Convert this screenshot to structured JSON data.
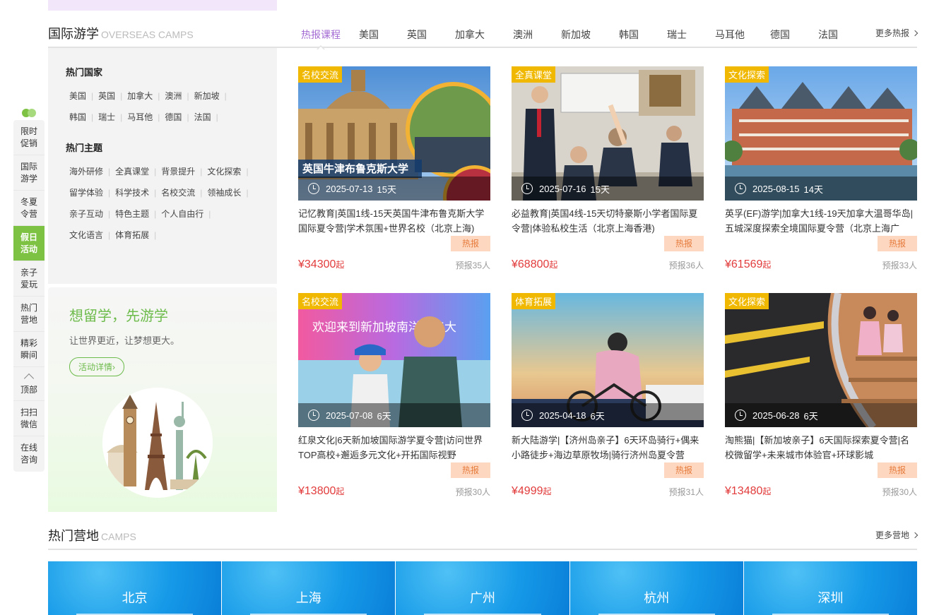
{
  "sidenav": {
    "items": [
      {
        "label": "限时促销",
        "active": false
      },
      {
        "label": "国际游学",
        "active": false
      },
      {
        "label": "冬夏令营",
        "active": false
      },
      {
        "label": "假日活动",
        "active": true
      },
      {
        "label": "亲子爱玩",
        "active": false
      },
      {
        "label": "热门营地",
        "active": false
      },
      {
        "label": "精彩瞬间",
        "active": false
      }
    ],
    "top_label": "顶部",
    "extra": [
      "扫扫微信",
      "在线咨询"
    ]
  },
  "overseas": {
    "title": "国际游学",
    "title_en": "OVERSEAS CAMPS",
    "tabs": [
      "热报课程",
      "美国",
      "英国",
      "加拿大",
      "澳洲",
      "新加坡",
      "韩国",
      "瑞士",
      "马耳他",
      "德国",
      "法国"
    ],
    "more": "更多热报"
  },
  "left_panel": {
    "countries_title": "热门国家",
    "countries": [
      "美国",
      "英国",
      "加拿大",
      "澳洲",
      "新加坡",
      "韩国",
      "瑞士",
      "马耳他",
      "德国",
      "法国"
    ],
    "themes_title": "热门主题",
    "themes": [
      "海外研修",
      "全真课堂",
      "背景提升",
      "文化探索",
      "留学体验",
      "科学技术",
      "名校交流",
      "领袖成长",
      "亲子互动",
      "特色主题",
      "个人自由行",
      "文化语言",
      "体育拓展"
    ]
  },
  "promo": {
    "title": "想留学，先游学",
    "subtitle": "让世界更近，让梦想更大。",
    "button": "活动详情›"
  },
  "cards": [
    {
      "tag": "名校交流",
      "date": "2025-07-13",
      "duration": "15天",
      "title": "记忆教育|英国1线-15天英国牛津布鲁克斯大学国际夏令营|学术氛围+世界名校（北京上海)",
      "hot": "热报",
      "price": "¥34300",
      "price_suffix": "起",
      "joined": "预报35人",
      "img_caption": "英国牛津布鲁克斯大学"
    },
    {
      "tag": "全真课堂",
      "date": "2025-07-16",
      "duration": "15天",
      "title": "必益教育|英国4线-15天切特豪斯小学者国际夏令营|体验私校生活（北京上海香港)",
      "hot": "热报",
      "price": "¥68800",
      "price_suffix": "起",
      "joined": "预报36人"
    },
    {
      "tag": "文化探索",
      "date": "2025-08-15",
      "duration": "14天",
      "title": "英孚(EF)游学|加拿大1线-19天加拿大温哥华岛|五城深度探索全境国际夏令营（北京上海广",
      "hot": "热报",
      "price": "¥61569",
      "price_suffix": "起",
      "joined": "预报33人"
    },
    {
      "tag": "名校交流",
      "date": "2025-07-08",
      "duration": "6天",
      "title": "红泉文化|6天新加坡国际游学夏令营|访问世界TOP高校+邂逅多元文化+开拓国际视野",
      "hot": "热报",
      "price": "¥13800",
      "price_suffix": "起",
      "joined": "预报30人",
      "img_caption": "欢迎来到新加坡南洋理工大"
    },
    {
      "tag": "体育拓展",
      "date": "2025-04-18",
      "duration": "6天",
      "title": "新大陆游学|【济州岛亲子】6天环岛骑行+偶来小路徒步+海边草原牧场|骑行济州岛夏令营",
      "hot": "热报",
      "price": "¥4999",
      "price_suffix": "起",
      "joined": "预报31人"
    },
    {
      "tag": "文化探索",
      "date": "2025-06-28",
      "duration": "6天",
      "title": "淘熊猫|【新加坡亲子】6天国际探索夏令营|名校微留学+未来城市体验官+环球影城",
      "hot": "热报",
      "price": "¥13480",
      "price_suffix": "起",
      "joined": "预报30人"
    }
  ],
  "camps": {
    "title": "热门营地",
    "title_en": "CAMPS",
    "more": "更多营地",
    "cities": [
      "北京",
      "上海",
      "广州",
      "杭州",
      "深圳"
    ]
  },
  "colors": {
    "accent": "#7dc243",
    "tab_active": "#a36bd3",
    "price": "#e23b3b",
    "tag": "#f0b800",
    "hot_bg": "#fdd7c0"
  }
}
